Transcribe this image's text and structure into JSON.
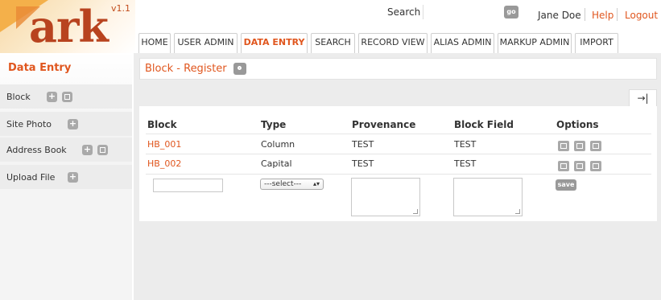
{
  "logo": {
    "text": "ark",
    "version": "v1.1"
  },
  "topbar": {
    "search_label": "Search",
    "go_label": "go",
    "user_name": "Jane Doe",
    "help_label": "Help",
    "logout_label": "Logout"
  },
  "tabs": [
    {
      "label": "HOME",
      "active": false
    },
    {
      "label": "USER ADMIN",
      "active": false
    },
    {
      "label": "DATA ENTRY",
      "active": true
    },
    {
      "label": "SEARCH",
      "active": false
    },
    {
      "label": "RECORD VIEW",
      "active": false
    },
    {
      "label": "ALIAS ADMIN",
      "active": false
    },
    {
      "label": "MARKUP ADMIN",
      "active": false
    },
    {
      "label": "IMPORT",
      "active": false
    }
  ],
  "sidebar": {
    "title": "Data Entry",
    "items": [
      {
        "label": "Block",
        "icons": [
          "add-icon",
          "list-icon"
        ]
      },
      {
        "label": "Site Photo",
        "icons": [
          "add-icon"
        ]
      },
      {
        "label": "Address Book",
        "icons": [
          "add-icon",
          "list-icon"
        ]
      },
      {
        "label": "Upload File",
        "icons": [
          "add-icon"
        ]
      }
    ]
  },
  "main": {
    "title": "Block - Register",
    "collapse_glyph": "→|",
    "table": {
      "columns": [
        "Block",
        "Type",
        "Provenance",
        "Block Field",
        "Options"
      ],
      "rows": [
        {
          "block": "HB_001",
          "type": "Column",
          "provenance": "TEST",
          "block_field": "TEST"
        },
        {
          "block": "HB_002",
          "type": "Capital",
          "provenance": "TEST",
          "block_field": "TEST"
        }
      ],
      "new_row": {
        "block_value": "",
        "type_select": "---select---",
        "provenance_value": "",
        "block_field_value": "",
        "save_label": "save"
      }
    }
  },
  "colors": {
    "accent": "#e0561e",
    "panel_bg": "#ececec",
    "icon_gray": "#a9a9a9"
  }
}
